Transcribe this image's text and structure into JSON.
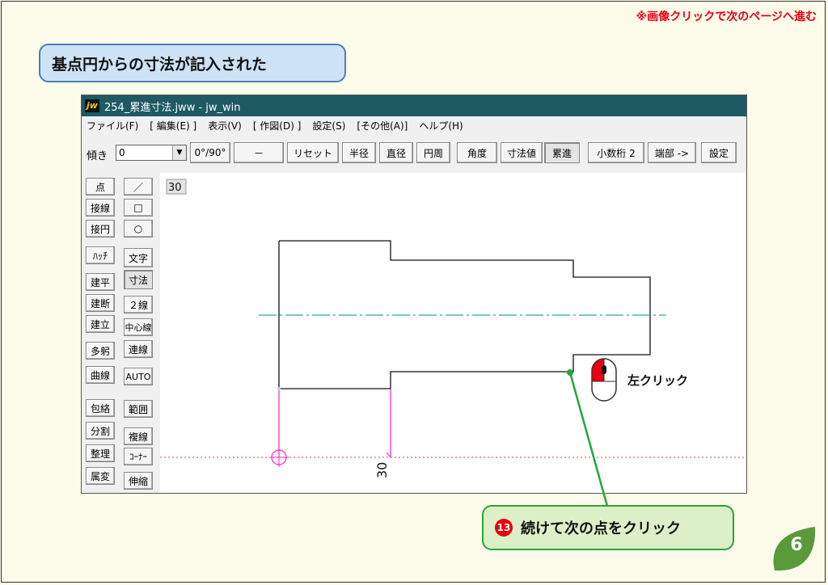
{
  "header": {
    "hint": "※画像クリックで次のページへ進む",
    "title": "基点円からの寸法が記入された"
  },
  "app": {
    "window_title": "254_累進寸法.jww - jw_win",
    "logo": "jw",
    "menu": [
      "ファイル(F)",
      "[ 編集(E) ]",
      "表示(V)",
      "[ 作図(D) ]",
      "設定(S)",
      "[その他(A)]",
      "ヘルプ(H)"
    ],
    "toolbar": {
      "slope_label": "傾き",
      "slope_value": "0",
      "buttons": [
        "0°/90°",
        "－",
        "リセット",
        "半径",
        "直径",
        "円周",
        "角度",
        "寸法値",
        "累進",
        "小数桁 2",
        "端部 ->",
        "設定"
      ],
      "pressed": "累進"
    },
    "sidebar_left": [
      "点",
      "接線",
      "接円",
      "ﾊｯﾁ",
      "建平",
      "建断",
      "建立",
      "多躬",
      "曲線",
      "包絡",
      "分割",
      "整理",
      "属変"
    ],
    "sidebar_right": [
      "／",
      "□",
      "○",
      "文字",
      "寸法",
      "２線",
      "中心線",
      "連線",
      "AUTO",
      "範囲",
      "複線",
      "ｺｰﾅｰ",
      "伸縮"
    ],
    "layer_indicator": "30",
    "dimension_text": "30"
  },
  "annotation": {
    "mouse_label": "左クリック",
    "step_number": "13",
    "step_text": "続けて次の点をクリック",
    "page_number": "6"
  },
  "colors": {
    "hint": "#e60012",
    "title_bg": "#cfe3f7",
    "title_border": "#4a7fb5",
    "callout_bg": "#dcf0c8",
    "callout_border": "#2aa33a",
    "dim_line": "#ff1fc8",
    "center_line": "#2aa6a6",
    "aux_line": "#ff3030",
    "leader": "#1fa83c",
    "page_badge": "#5a9a3a"
  }
}
